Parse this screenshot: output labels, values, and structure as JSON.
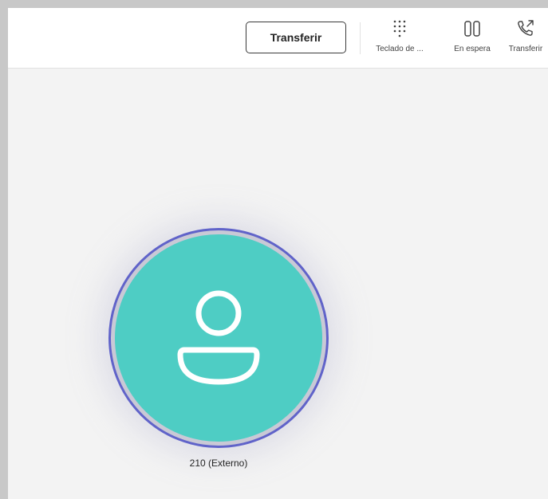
{
  "toolbar": {
    "transfer_button_label": "Transferir",
    "tools": [
      {
        "label": "Teclado de ...",
        "icon": "dialpad-icon"
      },
      {
        "label": "En espera",
        "icon": "hold-icon"
      },
      {
        "label": "Transferir",
        "icon": "call-transfer-icon"
      }
    ]
  },
  "call": {
    "caller_name": "210 (Externo)",
    "avatar_icon": "person-icon",
    "avatar_color": "#4ecdc4",
    "ring_color": "#6063c9"
  }
}
